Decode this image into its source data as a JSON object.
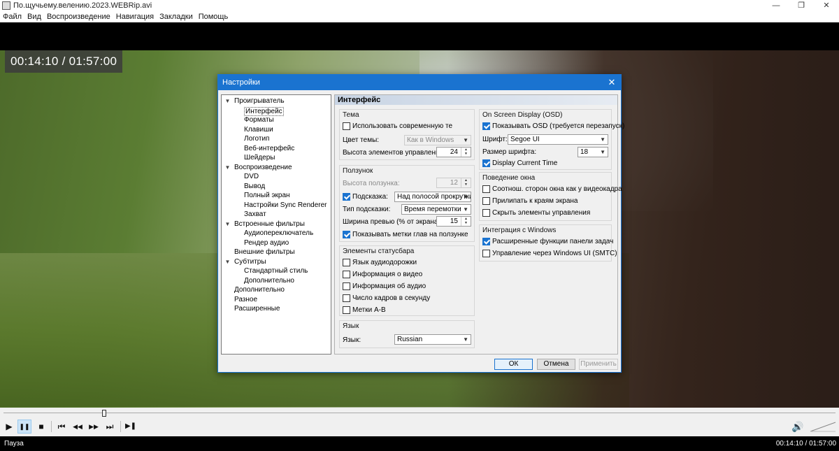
{
  "window": {
    "title": "По.щучьему.велению.2023.WEBRip.avi",
    "controls": [
      "—",
      "❐",
      "✕"
    ]
  },
  "menu": [
    "Файл",
    "Вид",
    "Воспроизведение",
    "Навигация",
    "Закладки",
    "Помощь"
  ],
  "osd": {
    "time": "00:14:10 / 01:57:00"
  },
  "dialog": {
    "title": "Настройки",
    "panel_title": "Интерфейс",
    "tree": [
      {
        "label": "Проигрыватель",
        "level": 0,
        "toggle": "▼"
      },
      {
        "label": "Интерфейс",
        "level": 1,
        "selected": true
      },
      {
        "label": "Форматы",
        "level": 1
      },
      {
        "label": "Клавиши",
        "level": 1
      },
      {
        "label": "Логотип",
        "level": 1
      },
      {
        "label": "Веб-интерфейс",
        "level": 1
      },
      {
        "label": "Шейдеры",
        "level": 1
      },
      {
        "label": "Воспроизведение",
        "level": 0,
        "toggle": "▼"
      },
      {
        "label": "DVD",
        "level": 1
      },
      {
        "label": "Вывод",
        "level": 1
      },
      {
        "label": "Полный экран",
        "level": 1
      },
      {
        "label": "Настройки Sync Renderer",
        "level": 1
      },
      {
        "label": "Захват",
        "level": 1
      },
      {
        "label": "Встроенные фильтры",
        "level": 0,
        "toggle": "▼"
      },
      {
        "label": "Аудиопереключатель",
        "level": 1
      },
      {
        "label": "Рендер аудио",
        "level": 1
      },
      {
        "label": "Внешние фильтры",
        "level": 0
      },
      {
        "label": "Субтитры",
        "level": 0,
        "toggle": "▼"
      },
      {
        "label": "Стандартный стиль",
        "level": 1
      },
      {
        "label": "Дополнительно",
        "level": 1
      },
      {
        "label": "Дополнительно",
        "level": 0
      },
      {
        "label": "Разное",
        "level": 0
      },
      {
        "label": "Расширенные",
        "level": 0
      }
    ],
    "theme": {
      "title": "Тема",
      "use_modern": "Использовать современную те",
      "color_label": "Цвет темы:",
      "color_value": "Как в Windows",
      "height_label": "Высота элементов управления:",
      "height_value": "24"
    },
    "seek": {
      "title": "Ползунок",
      "height_label": "Высота ползунка:",
      "height_value": "12",
      "tooltip_label": "Подсказка:",
      "tooltip_value": "Над полосой прокрутки",
      "tooltip_type_label": "Тип подсказки:",
      "tooltip_type_value": "Время перемотки",
      "preview_label": "Ширина превью (% от экрана)",
      "preview_value": "15",
      "chapters_label": "Показывать метки глав на ползунке"
    },
    "statusbar": {
      "title": "Элементы статусбара",
      "items": [
        "Язык аудиодорожки",
        "Информация о видео",
        "Информация об аудио",
        "Число кадров в секунду",
        "Метки A-B"
      ]
    },
    "language": {
      "title": "Язык",
      "label": "Язык:",
      "value": "Russian"
    },
    "osd": {
      "title": "On Screen Display (OSD)",
      "show_label": "Показывать OSD (требуется перезапуск)",
      "font_label": "Шрифт:",
      "font_value": "Segoe UI",
      "size_label": "Размер шрифта:",
      "size_value": "18",
      "current_time_label": "Display Current Time"
    },
    "window_behavior": {
      "title": "Поведение окна",
      "items": [
        "Соотнош. сторон окна как у видеокадра",
        "Прилипать к краям экрана",
        "Скрыть элементы управления"
      ]
    },
    "windows_integration": {
      "title": "Интеграция с Windows",
      "items": [
        "Расширенные функции панели задач",
        "Управление через Windows UI (SMTC)"
      ]
    },
    "buttons": {
      "ok": "ОК",
      "cancel": "Отмена",
      "apply": "Применить"
    }
  },
  "controls": {
    "play": "▶",
    "pause": "❚❚",
    "stop": "■",
    "prev": "⏮",
    "rewind": "◀◀",
    "forward": "▶▶",
    "next": "⏭",
    "frame_step": "▶❚",
    "volume": "🔊"
  },
  "status": {
    "state": "Пауза",
    "time": "00:14:10 / 01:57:00"
  },
  "progress": {
    "position_fraction": 0.121
  }
}
